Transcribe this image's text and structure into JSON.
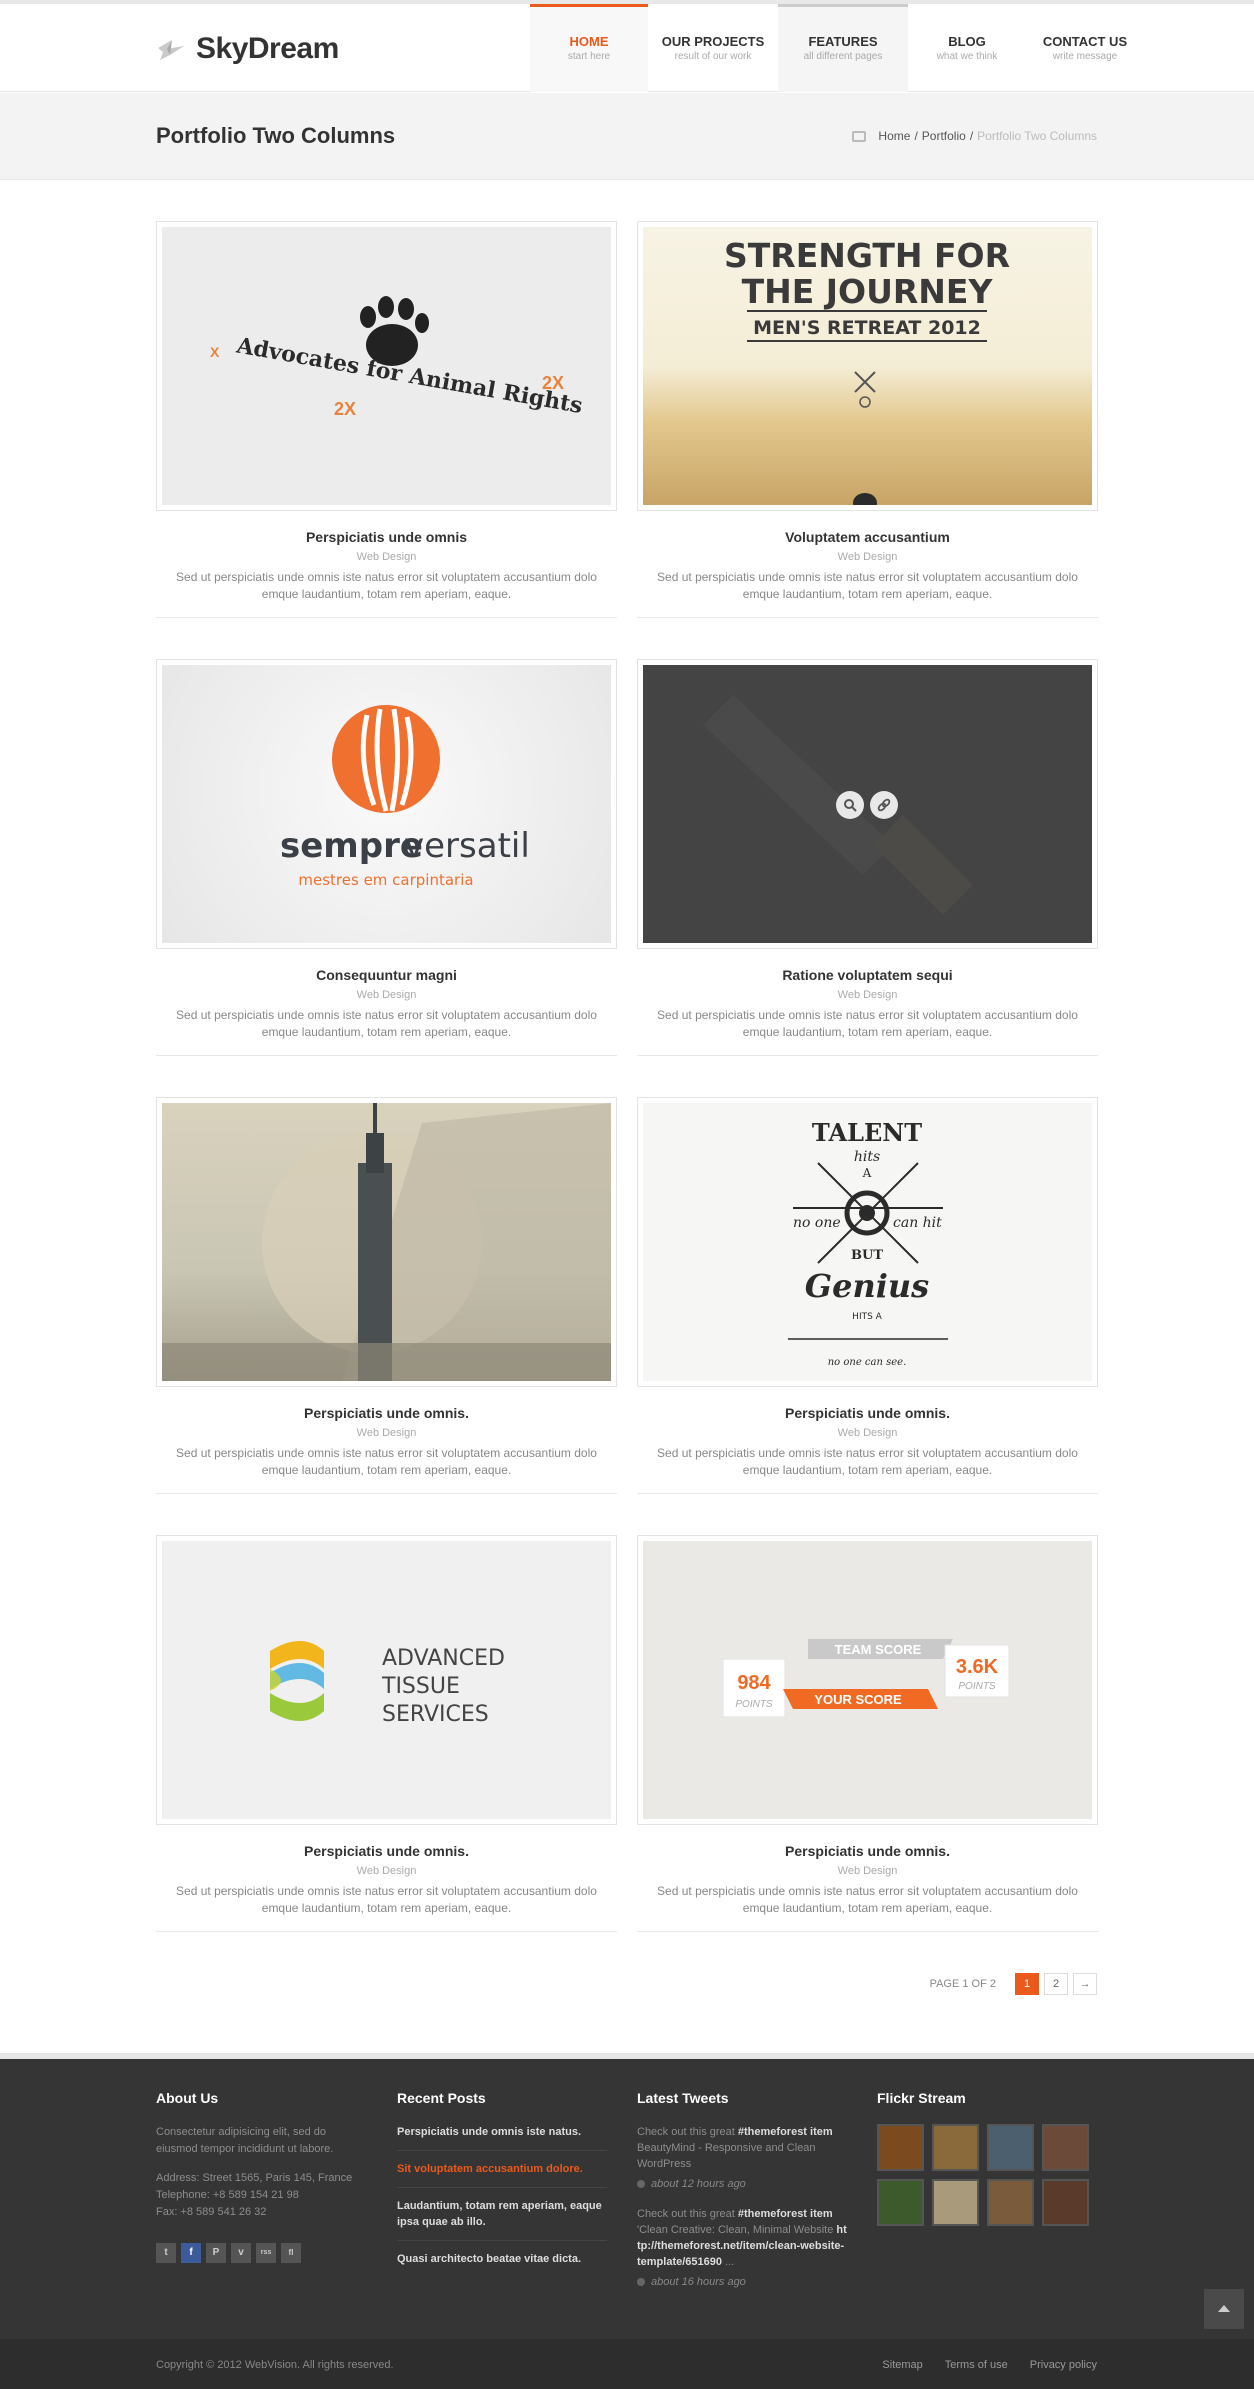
{
  "brand": {
    "name": "SkyDream"
  },
  "nav": [
    {
      "label": "HOME",
      "sub": "start here"
    },
    {
      "label": "OUR PROJECTS",
      "sub": "result of our work"
    },
    {
      "label": "FEATURES",
      "sub": "all different pages"
    },
    {
      "label": "BLOG",
      "sub": "what we think"
    },
    {
      "label": "CONTACT US",
      "sub": "write message"
    }
  ],
  "page": {
    "title": "Portfolio Two Columns"
  },
  "breadcrumb": {
    "home": "Home",
    "section": "Portfolio",
    "current": "Portfolio Two Columns",
    "sep": "/"
  },
  "portfolio": [
    {
      "title": "Perspiciatis unde omnis",
      "category": "Web Design",
      "desc": "Sed ut perspiciatis unde omnis iste natus error sit voluptatem accusantium dolo emque laudantium, totam rem aperiam, eaque."
    },
    {
      "title": "Voluptatem accusantium",
      "category": "Web Design",
      "desc": "Sed ut perspiciatis unde omnis iste natus error sit voluptatem accusantium dolo emque laudantium, totam rem aperiam, eaque."
    },
    {
      "title": "Consequuntur magni",
      "category": "Web Design",
      "desc": "Sed ut perspiciatis unde omnis iste natus error sit voluptatem accusantium dolo emque laudantium, totam rem aperiam, eaque."
    },
    {
      "title": "Ratione voluptatem sequi",
      "category": "Web Design",
      "desc": "Sed ut perspiciatis unde omnis iste natus error sit voluptatem accusantium dolo emque laudantium, totam rem aperiam, eaque."
    },
    {
      "title": "Perspiciatis unde omnis.",
      "category": "Web Design",
      "desc": "Sed ut perspiciatis unde omnis iste natus error sit voluptatem accusantium dolo emque laudantium, totam rem aperiam, eaque."
    },
    {
      "title": "Perspiciatis unde omnis.",
      "category": "Web Design",
      "desc": "Sed ut perspiciatis unde omnis iste natus error sit voluptatem accusantium dolo emque laudantium, totam rem aperiam, eaque."
    },
    {
      "title": "Perspiciatis unde omnis.",
      "category": "Web Design",
      "desc": "Sed ut perspiciatis unde omnis iste natus error sit voluptatem accusantium dolo emque laudantium, totam rem aperiam, eaque."
    },
    {
      "title": "Perspiciatis unde omnis.",
      "category": "Web Design",
      "desc": "Sed ut perspiciatis unde omnis iste natus error sit voluptatem accusantium dolo emque laudantium, totam rem aperiam, eaque."
    }
  ],
  "images": {
    "advocates": {
      "line1": "Advocates for Animal Rights",
      "mark": "2X",
      "xmark": "X"
    },
    "strength": {
      "line1": "STRENGTH FOR",
      "line2": "THE JOURNEY",
      "line3": "MEN'S RETREAT 2012"
    },
    "sempre": {
      "word1": "sempre",
      "word2": "versatil",
      "tagline": "mestres em carpintaria"
    },
    "talent": {
      "t1": "TALENT",
      "t2": "hits",
      "t3": "A",
      "t4": "no one",
      "t5": "can hit",
      "t6": "BUT",
      "t7": "Genius",
      "t8": "HITS A",
      "t9": "no one can see."
    },
    "tissue": {
      "l1": "ADVANCED",
      "l2": "TISSUE",
      "l3": "SERVICES"
    },
    "score": {
      "team_label": "TEAM SCORE",
      "your_label": "YOUR SCORE",
      "left_value": "984",
      "left_unit": "POINTS",
      "right_value": "3.6K",
      "right_unit": "POINTS"
    }
  },
  "pagination": {
    "info": "PAGE 1 OF 2",
    "pages": [
      "1",
      "2"
    ],
    "next": "→"
  },
  "footer": {
    "about": {
      "title": "About Us",
      "text": "Consectetur adipisicing elit, sed do eiusmod tempor incididunt ut labore.",
      "address": "Address: Street 1565, Paris 145, France",
      "phone": "Telephone: +8 589 154 21 98",
      "fax": "Fax: +8 589 541 26 32"
    },
    "recent": {
      "title": "Recent Posts",
      "posts": [
        "Perspiciatis unde omnis iste natus.",
        "Sit voluptatem accusantium dolore.",
        "Laudantium, totam rem aperiam, eaque ipsa quae ab illo.",
        "Quasi architecto beatae vitae dicta."
      ]
    },
    "tweets": {
      "title": "Latest Tweets",
      "items": [
        {
          "pre": "Check out this great ",
          "tag": "#themeforest item",
          "rest": " BeautyMind - Responsive and Clean WordPress",
          "time": "about 12 hours ago"
        },
        {
          "pre": "Check out this great ",
          "tag": "#themeforest item",
          "rest": " 'Clean Creative: Clean, Minimal Website ",
          "link": "http://themeforest.net/item/clean-website-template/651690",
          "tail": " ...",
          "time": "about 16 hours ago"
        }
      ]
    },
    "flickr": {
      "title": "Flickr Stream"
    },
    "social": [
      "t",
      "f",
      "P",
      "v",
      "rss",
      "fl"
    ],
    "copyright": "Copyright © 2012 WebVision. All rights reserved.",
    "links": [
      "Sitemap",
      "Terms of use",
      "Privacy policy"
    ]
  },
  "colors": {
    "accent": "#e95a1c",
    "footer_bg": "#353535",
    "dark_thumb": "#444444"
  }
}
